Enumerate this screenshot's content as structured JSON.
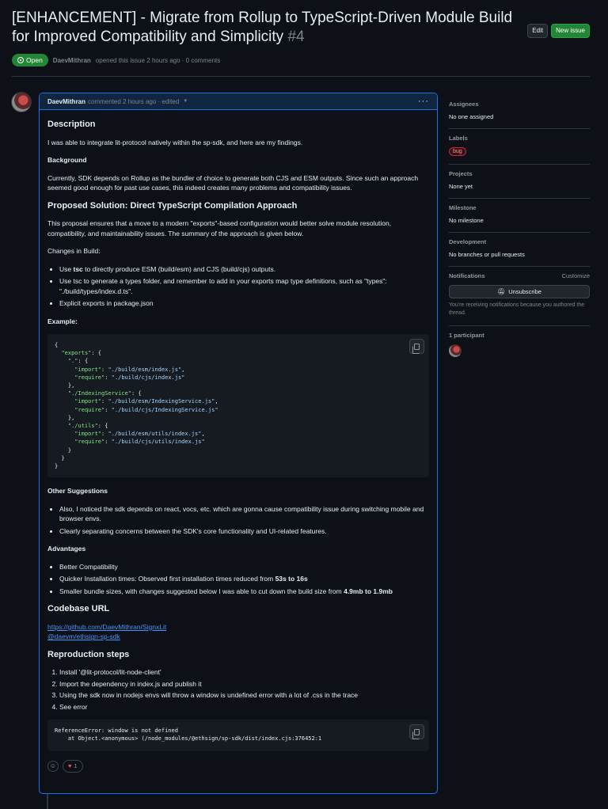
{
  "issue": {
    "title": "[ENHANCEMENT] - Migrate from Rollup to TypeScript-Driven Module Build for Improved Compatibility and Simplicity",
    "number": "#4",
    "state": "Open",
    "author": "DaevMithran",
    "meta_text": "opened this issue 2 hours ago · 0 comments"
  },
  "header_buttons": {
    "edit": "Edit",
    "new_issue": "New issue"
  },
  "comment": {
    "author": "DaevMithran",
    "meta": "commented 2 hours ago · edited",
    "description_heading": "Description",
    "description_text": "I was able to integrate lit-protocol natively within the sp-sdk, and here are my findings.",
    "background_heading": "Background",
    "background_text": "Currently, SDK depends on Rollup as the bundler of choice to generate both CJS and ESM outputs. Since such an approach seemed good enough for past use cases, this indeed creates many problems and compatibility issues.",
    "proposed_heading": "Proposed Solution: Direct TypeScript Compilation Approach",
    "proposed_text": "This proposal ensures that a move to a modern \"exports\"-based configuration would better solve module resolution, compatibility, and maintainability issues. The summary of the approach is given below.",
    "changes_text": "Changes in Build:",
    "changes": [
      {
        "pre": "Use ",
        "bold": "tsc",
        "post": " to directly produce ESM (build/esm) and CJS (build/cjs) outputs."
      },
      {
        "pre": "Use tsc to generate a types folder, and remember to add in your exports map type definitions, such as \"types\": \"./build/types/index.d.ts\".",
        "bold": "",
        "post": ""
      },
      {
        "pre": "Explicit exports in package.json",
        "bold": "",
        "post": ""
      }
    ],
    "example_heading": "Example:",
    "code_lines": [
      [
        [
          "p",
          "{"
        ]
      ],
      [
        [
          "p",
          "  "
        ],
        [
          "k",
          "\"exports\""
        ],
        [
          "p",
          ": {"
        ]
      ],
      [
        [
          "p",
          "    "
        ],
        [
          "k",
          "\".\""
        ],
        [
          "p",
          ": {"
        ]
      ],
      [
        [
          "p",
          "      "
        ],
        [
          "k",
          "\"import\""
        ],
        [
          "p",
          ": "
        ],
        [
          "s",
          "\"./build/esm/index.js\""
        ],
        [
          "p",
          ","
        ]
      ],
      [
        [
          "p",
          "      "
        ],
        [
          "k",
          "\"require\""
        ],
        [
          "p",
          ": "
        ],
        [
          "s",
          "\"./build/cjs/index.js\""
        ]
      ],
      [
        [
          "p",
          "    },"
        ]
      ],
      [
        [
          "p",
          "    "
        ],
        [
          "k",
          "\"./IndexingService\""
        ],
        [
          "p",
          ": {"
        ]
      ],
      [
        [
          "p",
          "      "
        ],
        [
          "k",
          "\"import\""
        ],
        [
          "p",
          ": "
        ],
        [
          "s",
          "\"./build/esm/IndexingService.js\""
        ],
        [
          "p",
          ","
        ]
      ],
      [
        [
          "p",
          "      "
        ],
        [
          "k",
          "\"require\""
        ],
        [
          "p",
          ": "
        ],
        [
          "s",
          "\"./build/cjs/IndexingService.js\""
        ]
      ],
      [
        [
          "p",
          "    },"
        ]
      ],
      [
        [
          "p",
          "    "
        ],
        [
          "k",
          "\"./utils\""
        ],
        [
          "p",
          ": {"
        ]
      ],
      [
        [
          "p",
          "      "
        ],
        [
          "k",
          "\"import\""
        ],
        [
          "p",
          ": "
        ],
        [
          "s",
          "\"./build/esm/utils/index.js\""
        ],
        [
          "p",
          ","
        ]
      ],
      [
        [
          "p",
          "      "
        ],
        [
          "k",
          "\"require\""
        ],
        [
          "p",
          ": "
        ],
        [
          "s",
          "\"./build/cjs/utils/index.js\""
        ]
      ],
      [
        [
          "p",
          "    }"
        ]
      ],
      [
        [
          "p",
          "  }"
        ]
      ],
      [
        [
          "p",
          "}"
        ]
      ]
    ],
    "other_heading": "Other Suggestions",
    "other": [
      "Also, I noticed the sdk depends on react, vocs, etc. which are gonna cause compatibility issue during switching mobile and browser envs.",
      "Clearly separating concerns between the SDK's core functionality and UI-related features."
    ],
    "advantages_heading": "Advantages",
    "advantages": [
      {
        "pre": "Better Compatibility",
        "bold": ""
      },
      {
        "pre": "Quicker Installation times: Observed first installation times reduced from ",
        "bold": "53s to 16s"
      },
      {
        "pre": "Smaller bundle sizes, with changes suggested below I was able to cut down the build size from ",
        "bold": "4.9mb to 1.9mb"
      }
    ],
    "codebase_heading": "Codebase URL",
    "links": [
      "https://github.com/DaevMithran/SignxLit",
      "@daevm/ethsign-sp-sdk"
    ],
    "repro_heading": "Reproduction steps",
    "repro": [
      "Install '@lit-protocol/lit-node-client'",
      "Import the dependency in index.js and publish it",
      "Using the sdk now in nodejs envs will throw a window is undefined error with a lot of .css in the trace",
      "See error"
    ],
    "error_lines": [
      "ReferenceError: window is not defined",
      "    at Object.<anonymous> (/node_modules/@ethsign/sp-sdk/dist/index.cjs:376452:1"
    ],
    "reaction_heart_count": "1"
  },
  "sidebar": {
    "assignees_label": "Assignees",
    "assignees_value": "No one assigned",
    "labels_label": "Labels",
    "label_bug": "bug",
    "projects_label": "Projects",
    "projects_value": "None yet",
    "milestone_label": "Milestone",
    "milestone_value": "No milestone",
    "development_label": "Development",
    "development_value": "No branches or pull requests",
    "notifications_label": "Notifications",
    "customize": "Customize",
    "unsubscribe": "Unsubscribe",
    "notif_note": "You're receiving notifications because you authored the thread.",
    "participants_label": "1 participant"
  },
  "colors": {
    "accent": "#1f6feb",
    "open_green": "#238636",
    "bug_red": "#d1242f",
    "bg": "#0d1117"
  }
}
